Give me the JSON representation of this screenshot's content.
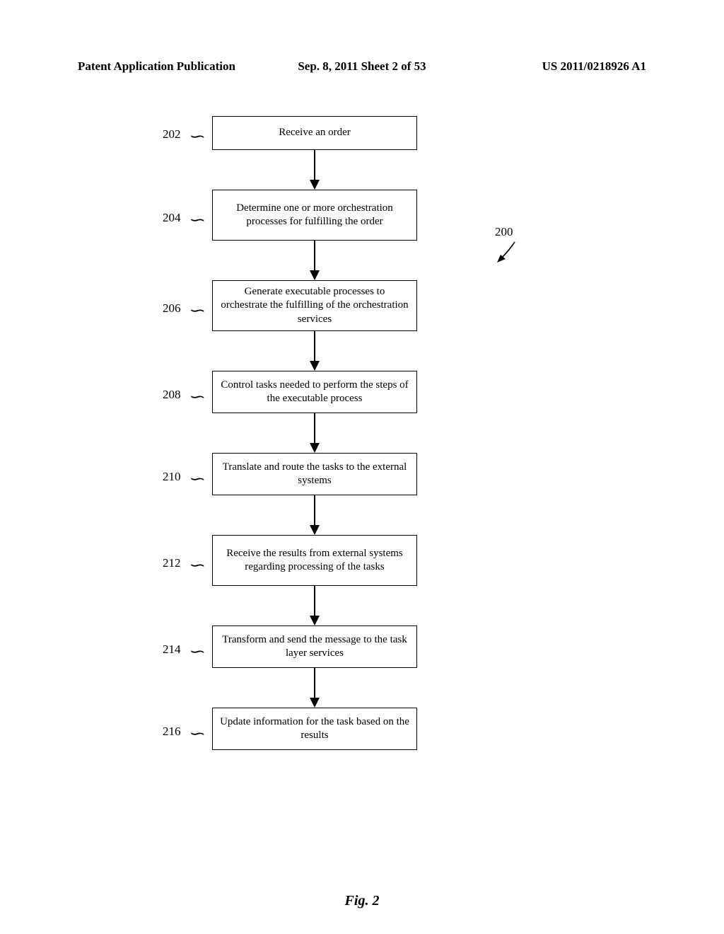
{
  "header": {
    "left": "Patent Application Publication",
    "center": "Sep. 8, 2011  Sheet 2 of 53",
    "right": "US 2011/0218926 A1"
  },
  "chart_data": {
    "type": "flowchart",
    "title": "Fig. 2",
    "ref": "200",
    "steps": [
      {
        "ref": "202",
        "text": "Receive an order"
      },
      {
        "ref": "204",
        "text": "Determine one or more orchestration processes for fulfilling the order"
      },
      {
        "ref": "206",
        "text": "Generate executable processes to orchestrate the fulfilling of the orchestration services"
      },
      {
        "ref": "208",
        "text": "Control tasks needed to perform the steps of the executable process"
      },
      {
        "ref": "210",
        "text": "Translate and route the tasks to the external systems"
      },
      {
        "ref": "212",
        "text": "Receive the results from external systems regarding processing of the tasks"
      },
      {
        "ref": "214",
        "text": "Transform and send the message to the task layer services"
      },
      {
        "ref": "216",
        "text": "Update information for the task based on the results"
      }
    ]
  },
  "figure_label": "Fig. 2"
}
